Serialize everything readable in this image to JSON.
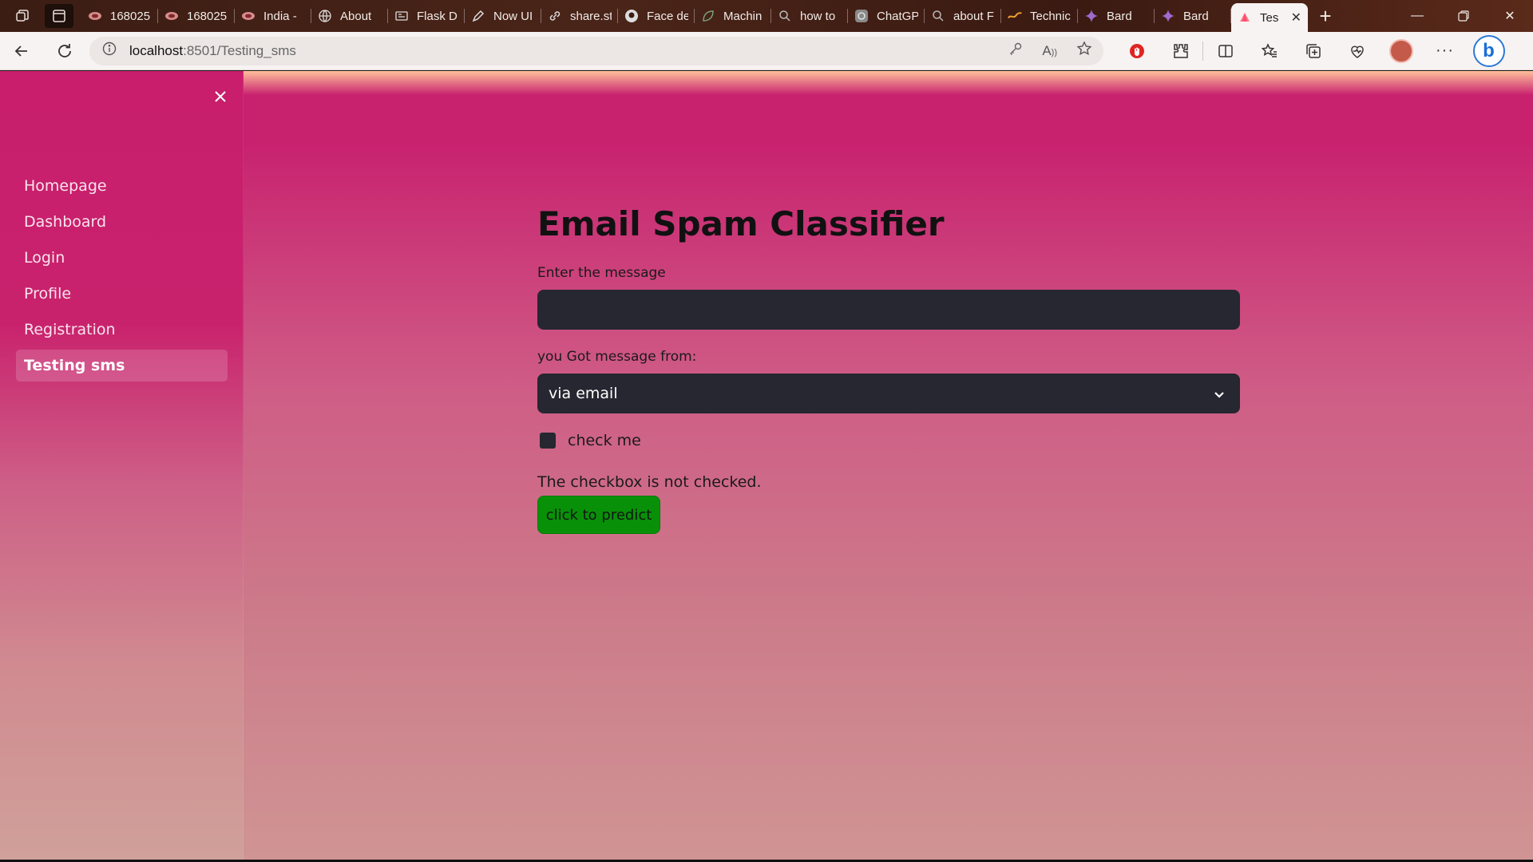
{
  "browser": {
    "tabs": [
      {
        "title": "168025",
        "icon": "image-icon"
      },
      {
        "title": "168025",
        "icon": "image-icon"
      },
      {
        "title": "India -",
        "icon": "image-icon"
      },
      {
        "title": "About",
        "icon": "globe-icon"
      },
      {
        "title": "Flask D",
        "icon": "document-icon"
      },
      {
        "title": "Now UI",
        "icon": "pen-icon"
      },
      {
        "title": "share.st",
        "icon": "link-icon"
      },
      {
        "title": "Face de",
        "icon": "github-icon"
      },
      {
        "title": "Machin",
        "icon": "leaf-icon"
      },
      {
        "title": "how to",
        "icon": "search-icon"
      },
      {
        "title": "ChatGP",
        "icon": "chatgpt-icon"
      },
      {
        "title": "about F",
        "icon": "search-icon"
      },
      {
        "title": "Technic",
        "icon": "bolt-icon"
      },
      {
        "title": "Bard",
        "icon": "sparkle-icon"
      },
      {
        "title": "Bard",
        "icon": "sparkle-icon"
      }
    ],
    "active_tab": {
      "title": "Tes",
      "icon": "streamlit-icon"
    },
    "address": {
      "host": "localhost",
      "rest": ":8501/Testing_sms"
    }
  },
  "sidebar": {
    "items": [
      {
        "label": "Homepage"
      },
      {
        "label": "Dashboard"
      },
      {
        "label": "Login"
      },
      {
        "label": "Profile"
      },
      {
        "label": "Registration"
      },
      {
        "label": "Testing sms",
        "active": true
      }
    ]
  },
  "main": {
    "title": "Email Spam Classifier",
    "message_label": "Enter the message",
    "message_value": "",
    "source_label": "you Got message from:",
    "source_selected": "via email",
    "checkbox_label": "check me",
    "checkbox_checked": false,
    "status_text": "The checkbox is not checked.",
    "predict_label": "click to predict"
  },
  "colors": {
    "accent": "#c8226f",
    "input_bg": "#262730",
    "button_green": "#089108"
  }
}
